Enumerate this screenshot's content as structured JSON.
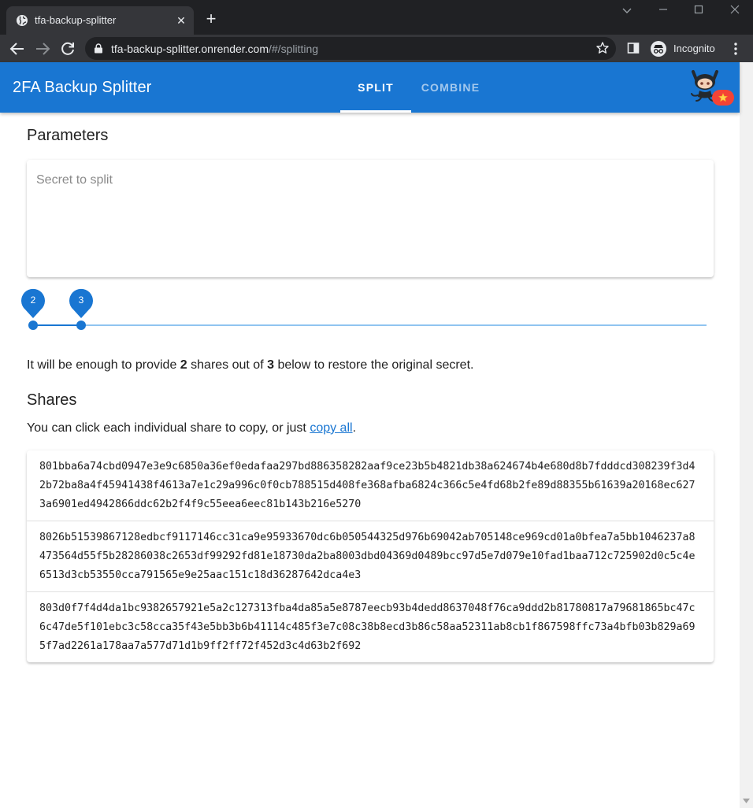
{
  "browser": {
    "tab_title": "tfa-backup-splitter",
    "url_host": "tfa-backup-splitter.onrender.com",
    "url_path": "/#/splitting",
    "profile_label": "Incognito"
  },
  "app": {
    "title": "2FA Backup Splitter",
    "tabs": [
      {
        "label": "SPLIT",
        "active": true
      },
      {
        "label": "COMBINE",
        "active": false
      }
    ],
    "colors": {
      "primary": "#1976d2",
      "track": "#90c4f0"
    }
  },
  "parameters": {
    "title": "Parameters",
    "secret_placeholder": "Secret to split",
    "secret_value": "",
    "threshold": 2,
    "total": 3,
    "threshold_label": "2",
    "total_label": "3"
  },
  "info": {
    "prefix": "It will be enough to provide ",
    "threshold": "2",
    "middle": " shares out of ",
    "total": "3",
    "suffix": " below to restore the original secret."
  },
  "shares": {
    "title": "Shares",
    "hint_prefix": "You can click each individual share to copy, or just ",
    "copy_all_label": "copy all",
    "hint_suffix": ".",
    "items": [
      "801bba6a74cbd0947e3e9c6850a36ef0edafaa297bd886358282aaf9ce23b5b4821db38a624674b4e680d8b7fdddcd308239f3d42b72ba8a4f45941438f4613a7e1c29a996c0f0cb788515d408fe368afba6824c366c5e4fd68b2fe89d88355b61639a20168ec6273a6901ed4942866ddc62b2f4f9c55eea6eec81b143b216e5270",
      "8026b51539867128edbcf9117146cc31ca9e95933670dc6b050544325d976b69042ab705148ce969cd01a0bfea7a5bb1046237a8473564d55f5b28286038c2653df99292fd81e18730da2ba8003dbd04369d0489bcc97d5e7d079e10fad1baa712c725902d0c5c4e6513d3cb53550cca791565e9e25aac151c18d36287642dca4e3",
      "803d0f7f4d4da1bc9382657921e5a2c127313fba4da85a5e8787eecb93b4dedd8637048f76ca9ddd2b81780817a79681865bc47c6c47de5f101ebc3c58cca35f43e5bb3b6b41114c485f3e7c08c38b8ecd3b86c58aa52311ab8cb1f867598ffc73a4bfb03b829a695f7ad2261a178aa7a577d71d1b9ff2ff72f452d3c4d63b2f692"
    ]
  },
  "icons": {
    "tab_favicon": "globe-icon",
    "github": "github-octocat-icon",
    "badge": "star-icon"
  }
}
